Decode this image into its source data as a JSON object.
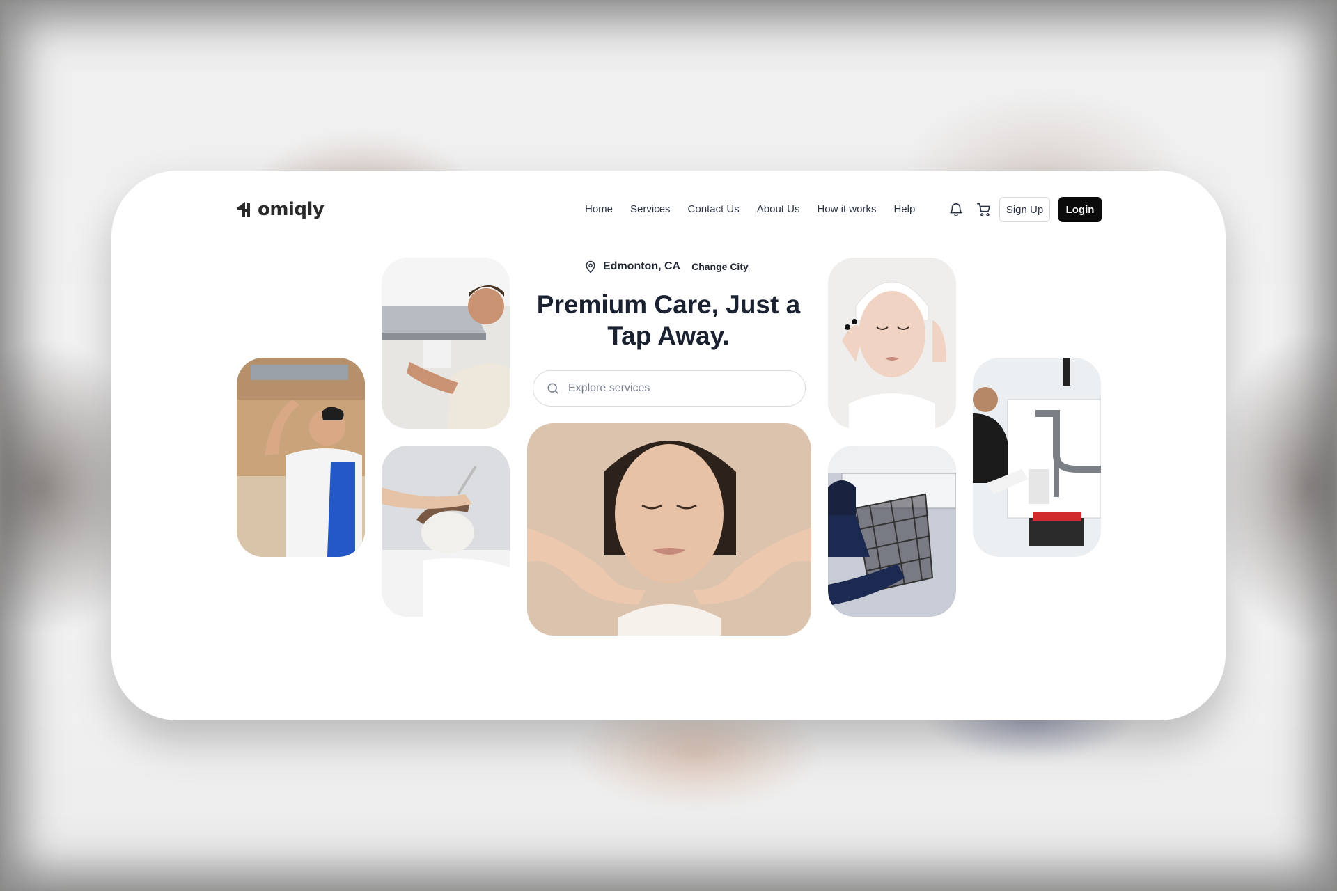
{
  "brand": {
    "name": "omiqly"
  },
  "nav": {
    "items": [
      "Home",
      "Services",
      "Contact Us",
      "About Us",
      "How it works",
      "Help"
    ]
  },
  "header": {
    "icons": [
      "bell-icon",
      "cart-icon"
    ],
    "signup_label": "Sign Up",
    "login_label": "Login"
  },
  "hero": {
    "location": "Edmonton, CA",
    "change_city": "Change City",
    "headline": "Premium Care, Just a Tap Away.",
    "search_placeholder": "Explore services"
  },
  "colors": {
    "text_dark": "#1a2130",
    "button_dark": "#0b0b0b",
    "border": "#d8dbe0"
  }
}
